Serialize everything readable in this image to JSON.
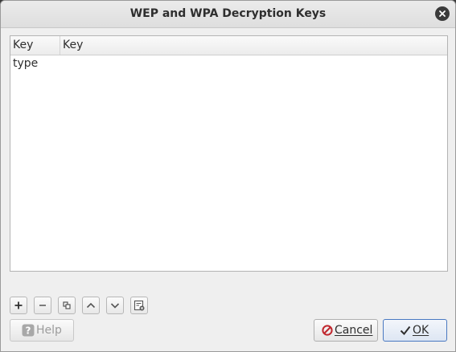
{
  "window": {
    "title": "WEP and WPA Decryption Keys"
  },
  "table": {
    "columns": [
      "Key type",
      "Key"
    ],
    "rows": []
  },
  "toolbar": {
    "items": [
      {
        "icon": "plus-icon",
        "action": "add"
      },
      {
        "icon": "minus-icon",
        "action": "remove"
      },
      {
        "icon": "copy-icon",
        "action": "copy"
      },
      {
        "icon": "chevron-up-icon",
        "action": "move-up"
      },
      {
        "icon": "chevron-down-icon",
        "action": "move-down"
      },
      {
        "icon": "clear-list-icon",
        "action": "clear"
      }
    ]
  },
  "buttons": {
    "help": "Help",
    "cancel": "Cancel",
    "ok": "OK"
  },
  "colors": {
    "window_bg": "#efefef",
    "cancel_icon": "#c0262d",
    "ok_focus_border": "#4a79c1"
  }
}
